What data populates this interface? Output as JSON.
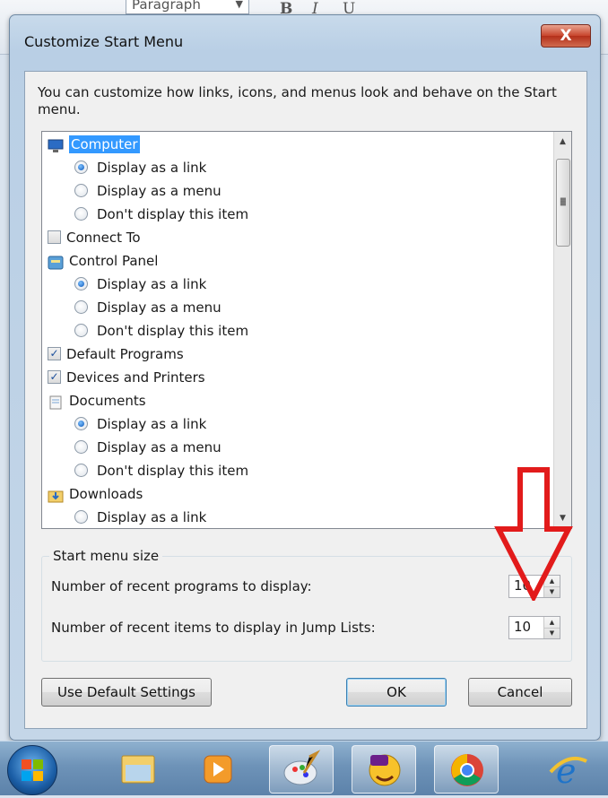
{
  "toolbar": {
    "paragraph_label": "Paragraph",
    "bold": "B",
    "italic": "I",
    "underline": "U"
  },
  "dialog": {
    "title": "Customize Start Menu",
    "close_label": "X",
    "description": "You can customize how links, icons, and menus look and behave on the Start menu."
  },
  "tree": {
    "rows": [
      {
        "type": "item",
        "icon": "computer-icon",
        "label": "Computer",
        "selected": true
      },
      {
        "type": "radio",
        "label": "Display as a link",
        "checked": true
      },
      {
        "type": "radio",
        "label": "Display as a menu",
        "checked": false
      },
      {
        "type": "radio",
        "label": "Don't display this item",
        "checked": false
      },
      {
        "type": "checkbox",
        "label": "Connect To",
        "checked": false
      },
      {
        "type": "item",
        "icon": "control-panel-icon",
        "label": "Control Panel"
      },
      {
        "type": "radio",
        "label": "Display as a link",
        "checked": true
      },
      {
        "type": "radio",
        "label": "Display as a menu",
        "checked": false
      },
      {
        "type": "radio",
        "label": "Don't display this item",
        "checked": false
      },
      {
        "type": "checkbox",
        "label": "Default Programs",
        "checked": true
      },
      {
        "type": "checkbox",
        "label": "Devices and Printers",
        "checked": true
      },
      {
        "type": "item",
        "icon": "documents-icon",
        "label": "Documents"
      },
      {
        "type": "radio",
        "label": "Display as a link",
        "checked": true
      },
      {
        "type": "radio",
        "label": "Display as a menu",
        "checked": false
      },
      {
        "type": "radio",
        "label": "Don't display this item",
        "checked": false
      },
      {
        "type": "item",
        "icon": "downloads-icon",
        "label": "Downloads"
      },
      {
        "type": "radio",
        "label": "Display as a link",
        "checked": false
      }
    ]
  },
  "start_menu_size": {
    "title": "Start menu size",
    "recent_programs_label": "Number of recent programs to display:",
    "recent_programs_value": "10",
    "jump_list_label": "Number of recent items to display in Jump Lists:",
    "jump_list_value": "10"
  },
  "buttons": {
    "default_settings": "Use Default Settings",
    "ok": "OK",
    "cancel": "Cancel"
  },
  "colors": {
    "selection": "#3399ff",
    "annotation_arrow": "#e21b1b"
  },
  "taskbar": {
    "items": [
      "start-orb-icon",
      "explorer-folder-icon",
      "media-player-icon",
      "paint-icon",
      "yahoo-messenger-icon",
      "chrome-icon",
      "internet-explorer-icon"
    ]
  }
}
